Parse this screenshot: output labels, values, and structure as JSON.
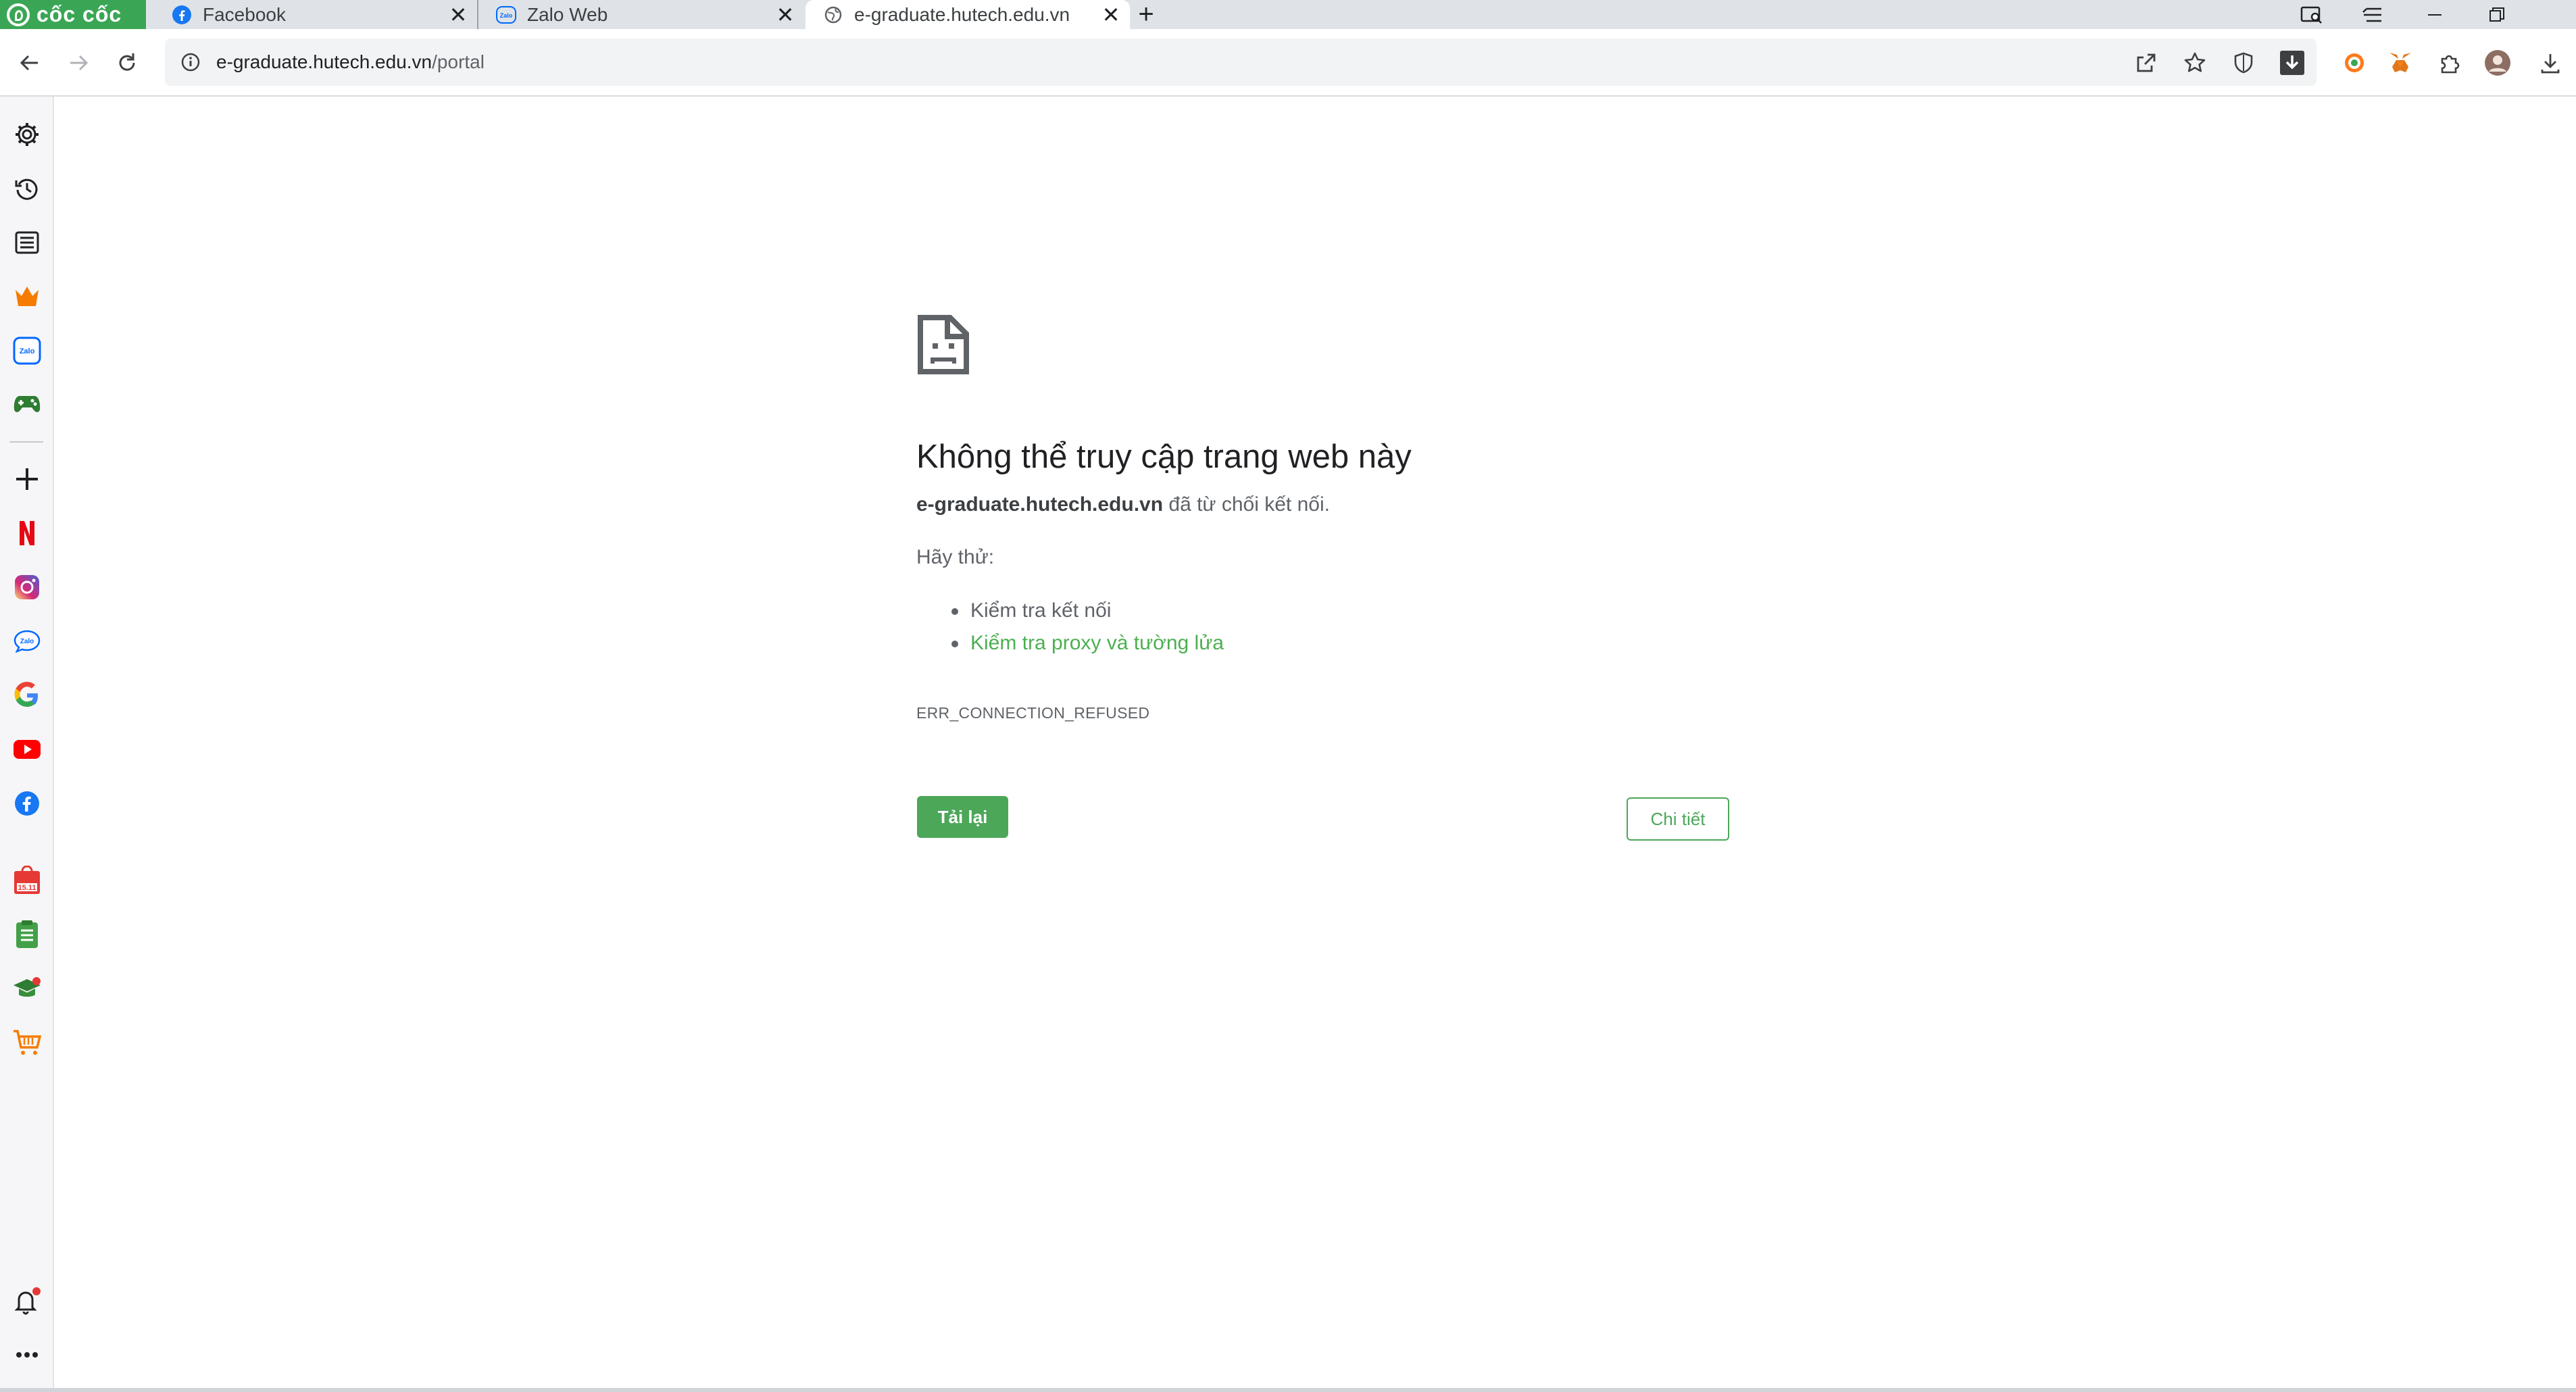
{
  "browser": {
    "brand": "cốc cốc",
    "brand_color": "#3aa655",
    "accent_color": "#4ca759"
  },
  "tabs": [
    {
      "label": "Facebook",
      "icon": "facebook-icon",
      "active": false
    },
    {
      "label": "Zalo Web",
      "icon": "zalo-icon",
      "active": false
    },
    {
      "label": "e-graduate.hutech.edu.vn",
      "icon": "globe-icon",
      "active": true
    }
  ],
  "toolbar": {
    "url_host": "e-graduate.hutech.edu.vn",
    "url_path": "/portal"
  },
  "sidebar": {
    "items": [
      {
        "icon": "settings-icon"
      },
      {
        "icon": "history-icon"
      },
      {
        "icon": "reading-list-icon"
      },
      {
        "icon": "crown-icon"
      },
      {
        "icon": "zalo-icon"
      },
      {
        "icon": "gamepad-icon"
      },
      {
        "icon": "add-icon"
      },
      {
        "icon": "netflix-icon"
      },
      {
        "icon": "instagram-icon"
      },
      {
        "icon": "zalo-icon"
      },
      {
        "icon": "google-icon"
      },
      {
        "icon": "youtube-icon"
      },
      {
        "icon": "messenger-icon"
      },
      {
        "icon": "shopping-bag-icon",
        "badge": "15.11"
      },
      {
        "icon": "notes-icon"
      },
      {
        "icon": "graduation-cap-icon"
      },
      {
        "icon": "cart-icon"
      }
    ]
  },
  "error": {
    "title": "Không thể truy cập trang web này",
    "host": "e-graduate.hutech.edu.vn",
    "desc_suffix": " đã từ chối kết nối.",
    "try_label": "Hãy thử:",
    "suggestions": [
      "Kiểm tra kết nối",
      "Kiểm tra proxy và tường lửa"
    ],
    "code": "ERR_CONNECTION_REFUSED",
    "reload_label": "Tải lại",
    "details_label": "Chi tiết"
  }
}
